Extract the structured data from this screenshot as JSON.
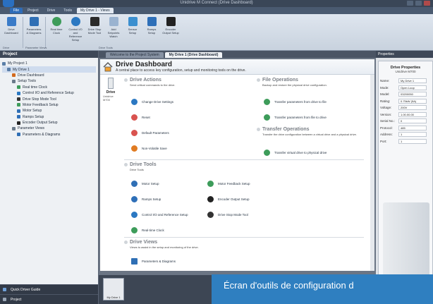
{
  "window": {
    "title": "Unidrive M Connect (Drive Dashboard)"
  },
  "ribbon": {
    "tabs": [
      "File",
      "Project",
      "Drive",
      "Tools",
      "My Drive 1 - Views"
    ],
    "buttons": [
      {
        "label": "Drive Dashboard",
        "icon": "dashboard-icon",
        "color": "#3a7bc8"
      },
      {
        "label": "Parameters & Diagrams",
        "icon": "parameters-icon",
        "color": "#2f6fb5"
      },
      {
        "label": "Real time Clock",
        "icon": "clock-icon",
        "color": "#3d9c5a"
      },
      {
        "label": "Control I/O and Reference Setup",
        "icon": "control-io-icon",
        "color": "#2b78c2"
      },
      {
        "label": "Drive Stop Mode Tool",
        "icon": "stop-mode-icon",
        "color": "#2a2a2a"
      },
      {
        "label": "Add Setpoints Watch",
        "icon": "watch-icon",
        "color": "#9ab3d0"
      },
      {
        "label": "Sensor Setup",
        "icon": "sensor-icon",
        "color": "#3b8fcf"
      },
      {
        "label": "Ramps Setup",
        "icon": "ramps-icon",
        "color": "#2e6fb8"
      },
      {
        "label": "Encoder Output Setup",
        "icon": "encoder-icon",
        "color": "#222"
      }
    ],
    "groups": [
      "Drive",
      "Parameter Views",
      "Drive Tools"
    ]
  },
  "project": {
    "header": "Project",
    "tree": [
      {
        "label": "My Project 1",
        "indent": 0,
        "color": "#5b7fa8"
      },
      {
        "label": "My Drive 1",
        "indent": 1,
        "color": "#5b7fa8",
        "selected": true
      },
      {
        "label": "Drive Dashboard",
        "indent": 2,
        "color": "#d2691e"
      },
      {
        "label": "Setup Tools",
        "indent": 2,
        "color": "#6a7a8a"
      },
      {
        "label": "Real time Clock",
        "indent": 3,
        "color": "#3d9c5a"
      },
      {
        "label": "Control I/O and Reference Setup",
        "indent": 3,
        "color": "#2b78c2"
      },
      {
        "label": "Drive Stop Mode Tool",
        "indent": 3,
        "color": "#333"
      },
      {
        "label": "Motor Feedback Setup",
        "indent": 3,
        "color": "#3d9c5a"
      },
      {
        "label": "Motor Setup",
        "indent": 3,
        "color": "#2f6fb5"
      },
      {
        "label": "Ramps Setup",
        "indent": 3,
        "color": "#2e6fb8"
      },
      {
        "label": "Encoder Output Setup",
        "indent": 3,
        "color": "#222"
      },
      {
        "label": "Parameter Views",
        "indent": 2,
        "color": "#6a7a8a"
      },
      {
        "label": "Parameters & Diagrams",
        "indent": 3,
        "color": "#2f6fb5"
      }
    ],
    "quick": [
      {
        "label": "Quick Driver Guide",
        "icon": "guide-icon",
        "color": "#6fa0d8"
      },
      {
        "label": "Project",
        "icon": "project-icon",
        "color": "#9aa6b6"
      }
    ]
  },
  "doc_tabs": [
    "Welcome to the Project System",
    "My Drive 1 (Drive Dashboard)"
  ],
  "dashboard": {
    "title": "Drive Dashboard",
    "subtitle": "A central place to access key configuration, setup and monitoring tools on the drive.",
    "drive_label": "Drive",
    "drive_model": "Unidrive M700",
    "actions": {
      "title": "Drive Actions",
      "desc": "Send critical commands to the drive.",
      "items": [
        {
          "label": "Change Drive Settings",
          "color": "#2b78c2"
        },
        {
          "label": "Reset",
          "color": "#d9534f"
        },
        {
          "label": "Default Parameters",
          "color": "#d9534f"
        },
        {
          "label": "Non-Volatile Save",
          "color": "#e07b22"
        }
      ]
    },
    "file_ops": {
      "title": "File Operations",
      "desc": "Backup and restore the physical drive configuration.",
      "items": [
        {
          "label": "Transfer parameters from drive to file",
          "color": "#3d9c5a"
        },
        {
          "label": "Transfer parameters from file to drive",
          "color": "#3d9c5a"
        }
      ]
    },
    "transfer_ops": {
      "title": "Transfer Operations",
      "desc": "Transfer the drive configuration between a virtual drive and a physical drive.",
      "items": [
        {
          "label": "Transfer virtual drive to physical drive",
          "color": "#3d9c5a"
        }
      ]
    },
    "tools": {
      "title": "Drive Tools",
      "desc": "Drive Tools",
      "items": [
        {
          "label": "Motor Setup",
          "color": "#2f6fb5"
        },
        {
          "label": "Motor Feedback Setup",
          "color": "#3d9c5a"
        },
        {
          "label": "Ramps Setup",
          "color": "#2e6fb8"
        },
        {
          "label": "Encoder Output Setup",
          "color": "#222"
        },
        {
          "label": "Control I/O and Reference Setup",
          "color": "#2b78c2"
        },
        {
          "label": "Drive Stop Mode Tool",
          "color": "#333"
        },
        {
          "label": "Real-time Clock",
          "color": "#3d9c5a"
        }
      ]
    },
    "views": {
      "title": "Drive Views",
      "desc": "Views to assist in the setup and monitoring of the drive.",
      "items": [
        {
          "label": "Parameters & Diagrams",
          "color": "#2f6fb5"
        }
      ]
    }
  },
  "tile": {
    "label": "My Drive 1"
  },
  "properties": {
    "header": "Properties",
    "title": "Drive Properties",
    "subtitle": "Unidrive M700",
    "rows": [
      {
        "key": "Name:",
        "value": "My Drive 1"
      },
      {
        "key": "Mode:",
        "value": "Open Loop"
      },
      {
        "key": "Model:",
        "value": "03200050"
      },
      {
        "key": "Rating:",
        "value": "0.75kW (5A)"
      },
      {
        "key": "Voltage:",
        "value": "200V"
      },
      {
        "key": "Version:",
        "value": "1.00.00.00"
      },
      {
        "key": "Serial No.:",
        "value": "0"
      },
      {
        "key": "Protocol:",
        "value": "485"
      },
      {
        "key": "Address:",
        "value": "1"
      },
      {
        "key": "Port:",
        "value": "1"
      }
    ]
  },
  "caption": "Écran d'outils de configuration d"
}
